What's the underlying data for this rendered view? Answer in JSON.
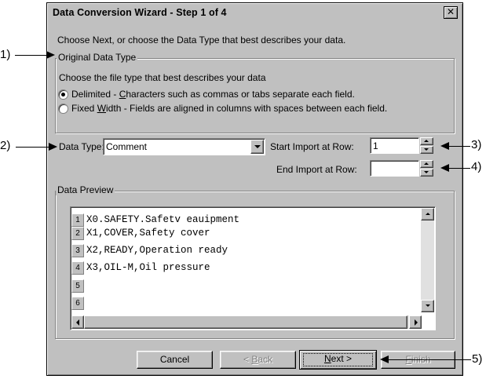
{
  "window": {
    "title": "Data Conversion Wizard - Step 1 of 4",
    "close_glyph": "✕"
  },
  "instructions": "Choose Next, or choose the Data Type that best describes your data.",
  "original_data_type": {
    "legend": "Original Data Type",
    "hint": "Choose the file type that best describes your data",
    "options": [
      {
        "prefix": "Delimited - ",
        "accel": "C",
        "rest": "haracters such as commas or tabs separate each field.",
        "selected": true
      },
      {
        "prefix": "Fixed ",
        "accel": "W",
        "rest": "idth - Fields are aligned in columns with spaces between each field.",
        "selected": false
      }
    ]
  },
  "data_type": {
    "label": "Data Type:",
    "value": "Comment"
  },
  "start_row": {
    "label": "Start Import at Row:",
    "value": "1"
  },
  "end_row": {
    "label": "End Import at Row:",
    "value": ""
  },
  "preview": {
    "legend": "Data Preview",
    "rows": [
      {
        "num": "1",
        "text": "X0.SAFETY.Safetv eauipment"
      },
      {
        "num": "2",
        "text": "X1,COVER,Safety cover"
      },
      {
        "num": "3",
        "text": "X2,READY,Operation ready"
      },
      {
        "num": "4",
        "text": "X3,OIL-M,Oil pressure"
      },
      {
        "num": "5",
        "text": ""
      },
      {
        "num": "6",
        "text": ""
      }
    ]
  },
  "buttons": {
    "cancel": "Cancel",
    "back_accel": "B",
    "back_prefix": "< ",
    "back_rest": "ack",
    "next_accel": "N",
    "next_rest": "ext >",
    "finish_accel": "F",
    "finish_rest": "inish"
  },
  "callouts": {
    "c1": "1)",
    "c2": "2)",
    "c3": "3)",
    "c4": "4)",
    "c5": "5)"
  }
}
